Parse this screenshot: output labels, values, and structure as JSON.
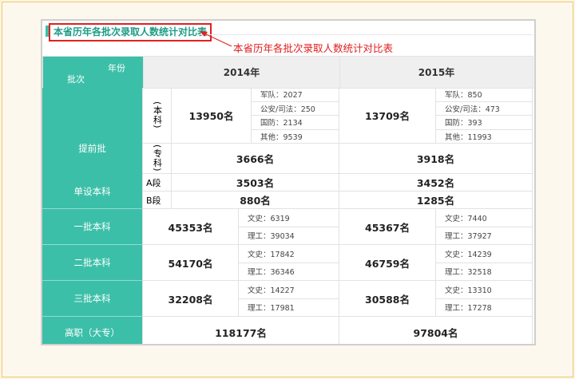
{
  "title": "本省历年各批次录取人数统计对比表",
  "annotation": "本省历年各批次录取人数统计对比表",
  "header": {
    "corner_year": "年份",
    "corner_batch": "批次",
    "year1": "2014年",
    "year2": "2015年"
  },
  "arrow_up": "↑",
  "arrow_down": "↓",
  "tiqian": {
    "label": "提前批",
    "benke_label": "(本科)",
    "zhuanke_label": "(专科)",
    "benke_2014": "13950名",
    "benke_2014_sub": [
      "军队：2027",
      "公安/司法：250",
      "国防：2134",
      "其他：9539"
    ],
    "benke_2015": "13709名",
    "benke_2015_sub": [
      "军队：850",
      "公安/司法：473",
      "国防：393",
      "其他：11993"
    ],
    "zhuanke_2014": "3666名",
    "zhuanke_2015": "3918名"
  },
  "danshe": {
    "label": "单设本科",
    "a_label": "A段",
    "b_label": "B段",
    "a_2014": "3503名",
    "a_2015": "3452名",
    "b_2014": "880名",
    "b_2015": "1285名"
  },
  "yipi": {
    "label": "一批本科",
    "v2014": "45353名",
    "s2014": [
      "文史：6319",
      "理工：39034"
    ],
    "v2015": "45367名",
    "s2015": [
      "文史：7440",
      "理工：37927"
    ]
  },
  "erpi": {
    "label": "二批本科",
    "v2014": "54170名",
    "s2014": [
      "文史：17842",
      "理工：36346"
    ],
    "v2015": "46759名",
    "s2015": [
      "文史：14239",
      "理工：32518"
    ]
  },
  "sanpi": {
    "label": "三批本科",
    "v2014": "32208名",
    "s2014": [
      "文史：14227",
      "理工：17981"
    ],
    "v2015": "30588名",
    "s2015": [
      "文史：13310",
      "理工：17278"
    ]
  },
  "gaozhi": {
    "label": "高职（大专）",
    "v2014": "118177名",
    "v2015": "97804名"
  },
  "colors": {
    "teal": "#3cbfa8",
    "red": "#e02020",
    "arrow": "#e05030"
  }
}
